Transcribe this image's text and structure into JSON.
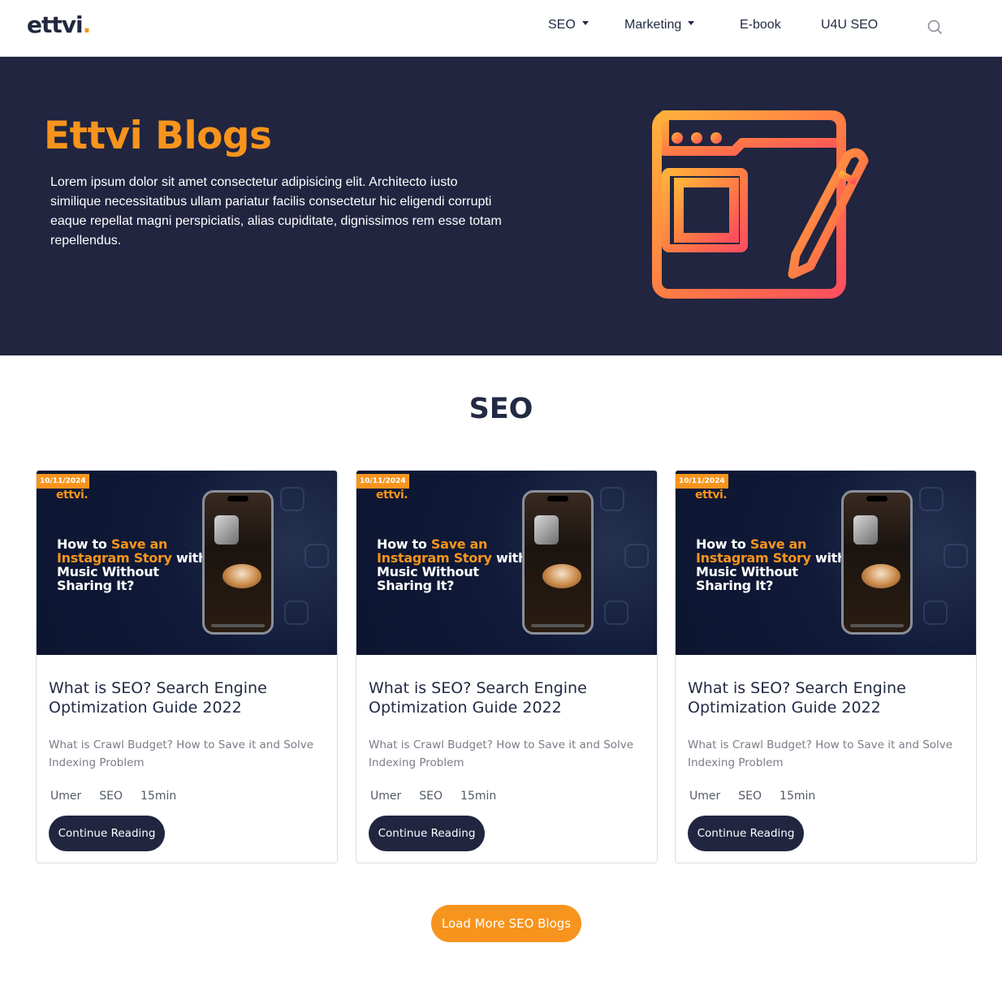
{
  "header": {
    "logo_text": "ettvi",
    "logo_dot": ".",
    "nav": [
      {
        "label": "SEO",
        "has_dropdown": true
      },
      {
        "label": "Marketing",
        "has_dropdown": true
      },
      {
        "label": "E-book",
        "has_dropdown": false
      },
      {
        "label": "U4U SEO",
        "has_dropdown": false
      }
    ],
    "search_icon": "search-icon"
  },
  "hero": {
    "title": "Ettvi Blogs",
    "text": "Lorem ipsum dolor sit amet consectetur adipisicing elit. Architecto iusto similique necessitatibus ullam pariatur facilis consectetur hic eligendi corrupti eaque repellat magni perspiciatis, alias cupiditate, dignissimos rem esse totam repellendus.",
    "icon": "blog-article-edit-icon"
  },
  "section": {
    "title": "SEO"
  },
  "cards": [
    {
      "thumb_date": "10/11/2024",
      "thumb_brand": "ettvi.",
      "thumb_headline_1": "How to ",
      "thumb_headline_2": "Save an Instagram Story",
      "thumb_headline_3": " with Music Without Sharing It?",
      "title": "What is SEO? Search Engine Optimization Guide 2022",
      "description": "What is Crawl Budget? How to Save it and Solve Indexing Problem",
      "author": "Umer",
      "category": "SEO",
      "read_time": "15min",
      "button": "Continue Reading"
    },
    {
      "thumb_date": "10/11/2024",
      "thumb_brand": "ettvi.",
      "thumb_headline_1": "How to ",
      "thumb_headline_2": "Save an Instagram Story",
      "thumb_headline_3": " with Music Without Sharing It?",
      "title": "What is SEO? Search Engine Optimization Guide 2022",
      "description": "What is Crawl Budget? How to Save it and Solve Indexing Problem",
      "author": "Umer",
      "category": "SEO",
      "read_time": "15min",
      "button": "Continue Reading"
    },
    {
      "thumb_date": "10/11/2024",
      "thumb_brand": "ettvi.",
      "thumb_headline_1": "How to ",
      "thumb_headline_2": "Save an Instagram Story",
      "thumb_headline_3": " with Music Without Sharing It?",
      "title": "What is SEO? Search Engine Optimization Guide 2022",
      "description": "What is Crawl Budget? How to Save it and Solve Indexing Problem",
      "author": "Umer",
      "category": "SEO",
      "read_time": "15min",
      "button": "Continue Reading"
    }
  ],
  "load_more": "Load More SEO Blogs",
  "colors": {
    "accent": "#f7941d",
    "navy": "#212540",
    "text": "#222a44"
  }
}
